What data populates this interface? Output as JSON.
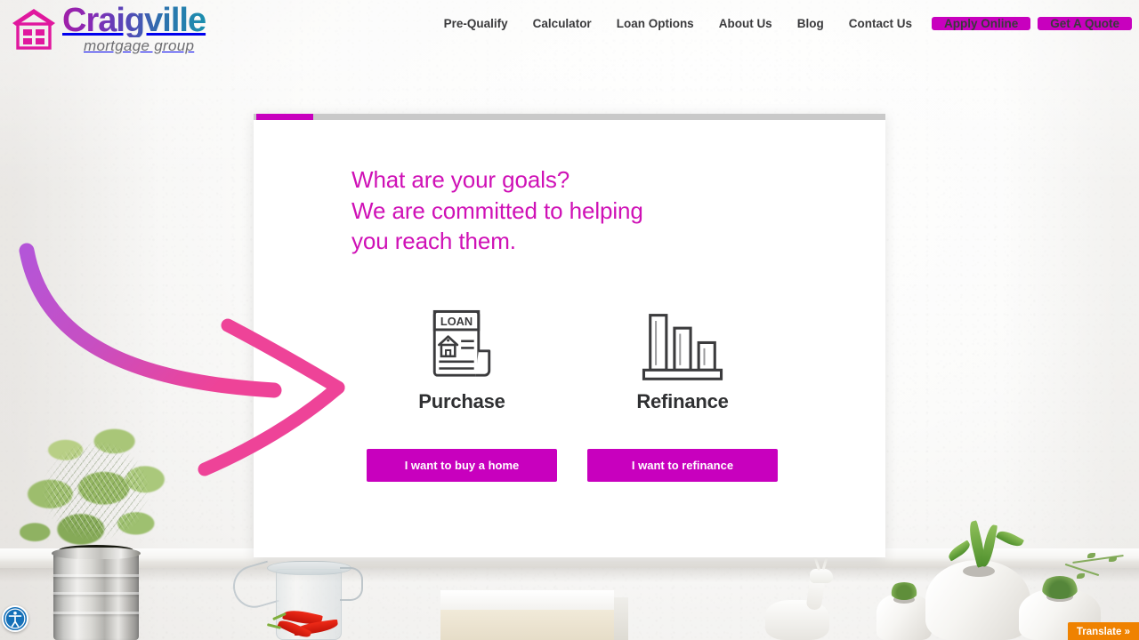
{
  "brand": {
    "name": "Craigville",
    "tagline": "mortgage group",
    "logo_icon": "house-logo-icon",
    "accent_color": "#c800be",
    "gradient_start": "#a21fa8",
    "gradient_end": "#1b8fae"
  },
  "nav": {
    "links": [
      {
        "label": "Pre-Qualify"
      },
      {
        "label": "Calculator"
      },
      {
        "label": "Loan Options"
      },
      {
        "label": "About Us"
      },
      {
        "label": "Blog"
      },
      {
        "label": "Contact Us"
      }
    ],
    "buttons": [
      {
        "label": "Apply Online"
      },
      {
        "label": "Get A Quote"
      }
    ]
  },
  "modal": {
    "progress_percent": 9,
    "heading_line1": "What are your goals?",
    "heading_line2": "We are committed to helping",
    "heading_line3": "you reach them.",
    "options": [
      {
        "icon": "loan-document-icon",
        "icon_text": "LOAN",
        "label": "Purchase",
        "cta": "I want to buy a home"
      },
      {
        "icon": "bar-chart-icon",
        "label": "Refinance",
        "cta": "I want to refinance"
      }
    ]
  },
  "annotation": {
    "arrow_icon": "curved-arrow-icon",
    "color_start": "#b455d8",
    "color_end": "#ee4398"
  },
  "widgets": {
    "accessibility": {
      "icon": "accessibility-icon",
      "color": "#1570b8"
    },
    "translate": {
      "label": "Translate »",
      "color": "#ef8200"
    }
  }
}
